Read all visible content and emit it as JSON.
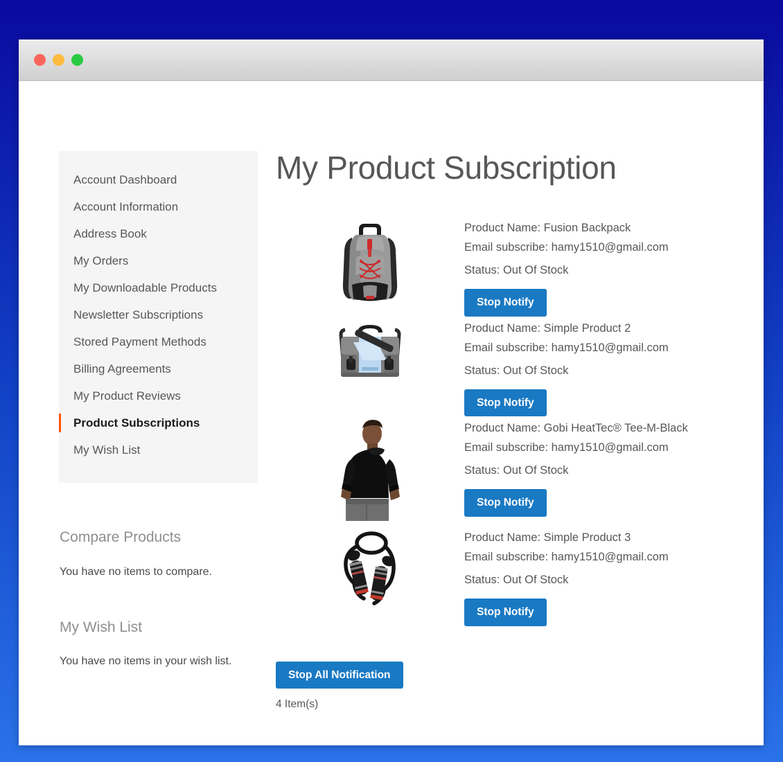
{
  "window": {
    "traffic_lights": [
      {
        "name": "close",
        "color": "#f9655b"
      },
      {
        "name": "minimize",
        "color": "#fdbc40"
      },
      {
        "name": "maximize",
        "color": "#2acb42"
      }
    ]
  },
  "theme": {
    "background_top": "#0a0a9e",
    "background_bottom": "#2a72e8",
    "accent_button": "#1979c3",
    "active_nav_marker": "#ff5501",
    "sidebar_panel": "#f5f5f5",
    "body_text": "#575757"
  },
  "sidebar": {
    "items": [
      {
        "label": "Account Dashboard",
        "current": false
      },
      {
        "label": "Account Information",
        "current": false
      },
      {
        "label": "Address Book",
        "current": false
      },
      {
        "label": "My Orders",
        "current": false
      },
      {
        "label": "My Downloadable Products",
        "current": false
      },
      {
        "label": "Newsletter Subscriptions",
        "current": false
      },
      {
        "label": "Stored Payment Methods",
        "current": false
      },
      {
        "label": "Billing Agreements",
        "current": false
      },
      {
        "label": "My Product Reviews",
        "current": false
      },
      {
        "label": "Product Subscriptions",
        "current": true
      },
      {
        "label": "My Wish List",
        "current": false
      }
    ],
    "compare_block": {
      "title": "Compare Products",
      "empty_text": "You have no items to compare."
    },
    "wishlist_block": {
      "title": "My Wish List",
      "empty_text": "You have no items in your wish list."
    }
  },
  "main": {
    "page_title": "My Product Subscription",
    "subscriptions": [
      {
        "thumb": "fusion-backpack-image",
        "product_name": "Product Name: Fusion Backpack",
        "email_subscribe": "Email subscribe: hamy1510@gmail.com",
        "status": "Status: Out Of Stock",
        "action_label": "Stop Notify"
      },
      {
        "thumb": "messenger-bag-image",
        "product_name": "Product Name: Simple Product 2",
        "email_subscribe": "Email subscribe: hamy1510@gmail.com",
        "status": "Status: Out Of Stock",
        "action_label": "Stop Notify"
      },
      {
        "thumb": "black-tee-model-image",
        "product_name": "Product Name: Gobi HeatTec® Tee-M-Black",
        "email_subscribe": "Email subscribe: hamy1510@gmail.com",
        "status": "Status: Out Of Stock",
        "action_label": "Stop Notify"
      },
      {
        "thumb": "jump-rope-image",
        "product_name": "Product Name: Simple Product 3",
        "email_subscribe": "Email subscribe: hamy1510@gmail.com",
        "status": "Status: Out Of Stock",
        "action_label": "Stop Notify"
      }
    ],
    "stop_all_label": "Stop All Notification",
    "item_count": "4 Item(s)"
  }
}
